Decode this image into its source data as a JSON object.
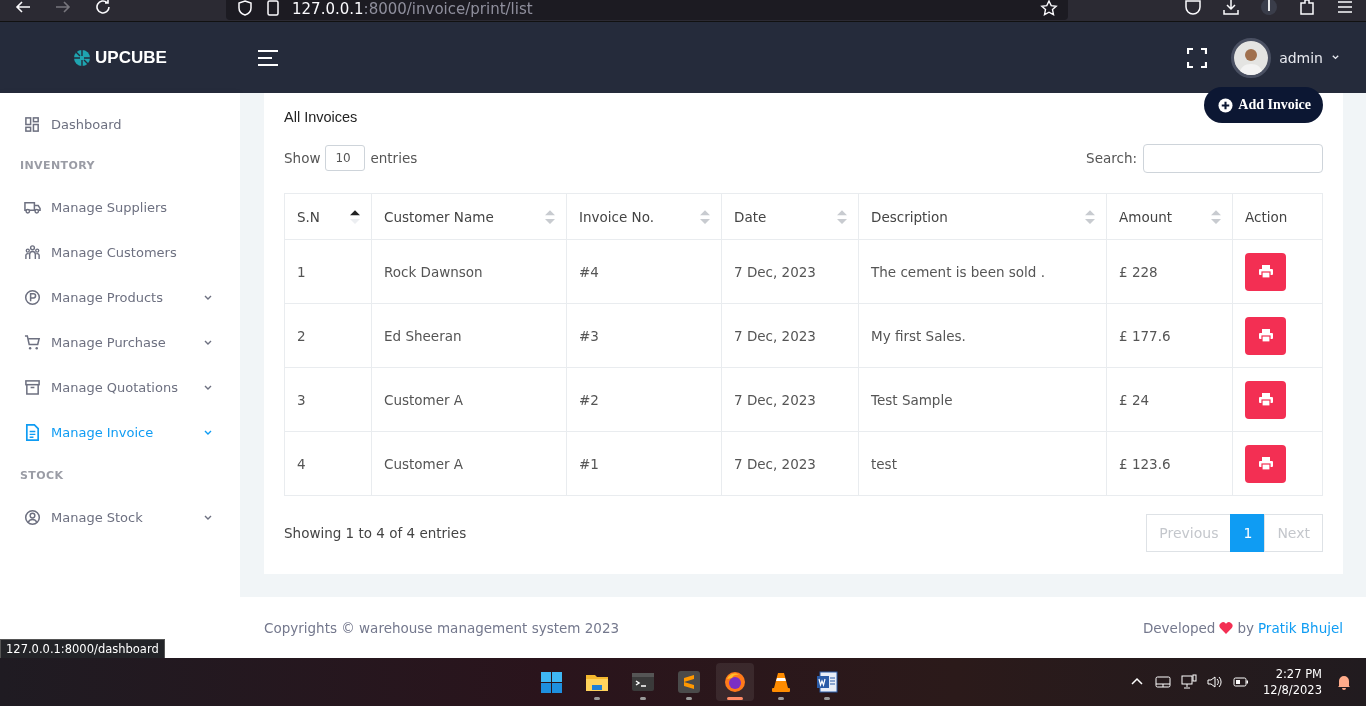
{
  "browser": {
    "url_host": "127.0.0.1",
    "url_rest": ":8000/invoice/print/list"
  },
  "header": {
    "brand": "UPCUBE",
    "user": "admin"
  },
  "sidebar": {
    "items": [
      {
        "kind": "link",
        "label": "Dashboard",
        "selected": false,
        "expandable": false
      },
      {
        "kind": "heading",
        "label": "INVENTORY"
      },
      {
        "kind": "link",
        "label": "Manage Suppliers",
        "selected": false,
        "expandable": false
      },
      {
        "kind": "link",
        "label": "Manage Customers",
        "selected": false,
        "expandable": false
      },
      {
        "kind": "link",
        "label": "Manage Products",
        "selected": false,
        "expandable": true
      },
      {
        "kind": "link",
        "label": "Manage Purchase",
        "selected": false,
        "expandable": true
      },
      {
        "kind": "link",
        "label": "Manage Quotations",
        "selected": false,
        "expandable": true
      },
      {
        "kind": "link",
        "label": "Manage Invoice",
        "selected": true,
        "expandable": true
      },
      {
        "kind": "heading",
        "label": "STOCK"
      },
      {
        "kind": "link",
        "label": "Manage Stock",
        "selected": false,
        "expandable": true
      }
    ]
  },
  "card": {
    "title": "All Invoices",
    "add_button": "Add Invoice",
    "show_label": "Show",
    "page_size": "10",
    "entries_label": "entries",
    "search_label": "Search:",
    "table": {
      "columns": [
        {
          "label": "S.N",
          "sortable": true,
          "sorted": true
        },
        {
          "label": "Customer Name",
          "sortable": true,
          "sorted": false
        },
        {
          "label": "Invoice No.",
          "sortable": true,
          "sorted": false
        },
        {
          "label": "Date",
          "sortable": true,
          "sorted": false
        },
        {
          "label": "Description",
          "sortable": true,
          "sorted": false
        },
        {
          "label": "Amount",
          "sortable": true,
          "sorted": false
        },
        {
          "label": "Action",
          "sortable": false
        }
      ],
      "rows": [
        {
          "cells": [
            "1",
            "Rock Dawnson",
            "#4",
            "7 Dec, 2023",
            "The cement is been sold .",
            "£ 228"
          ]
        },
        {
          "cells": [
            "2",
            "Ed Sheeran",
            "#3",
            "7 Dec, 2023",
            "My first Sales.",
            "£ 177.6"
          ]
        },
        {
          "cells": [
            "3",
            "Customer A",
            "#2",
            "7 Dec, 2023",
            "Test Sample",
            "£ 24"
          ]
        },
        {
          "cells": [
            "4",
            "Customer A",
            "#1",
            "7 Dec, 2023",
            "test",
            "£ 123.6"
          ]
        }
      ]
    },
    "info": "Showing 1 to 4 of 4 entries",
    "pagination": [
      {
        "label": "Previous",
        "disabled": true,
        "selected": false
      },
      {
        "label": "1",
        "disabled": false,
        "selected": true
      },
      {
        "label": "Next",
        "disabled": true,
        "selected": false
      }
    ]
  },
  "footer": {
    "copyright": "Copyrights © warehouse management system 2023",
    "developed": "Developed",
    "by": "by",
    "author": "Pratik Bhujel"
  },
  "status_tooltip": "127.0.0.1:8000/dashboard",
  "taskbar": {
    "apps": [
      {
        "kind": "start",
        "running": false,
        "active": false
      },
      {
        "kind": "folder",
        "running": true,
        "active": false
      },
      {
        "kind": "terminal",
        "running": true,
        "active": false
      },
      {
        "kind": "sublime",
        "running": true,
        "active": false
      },
      {
        "kind": "firefox",
        "running": true,
        "active": true
      },
      {
        "kind": "vlc",
        "running": true,
        "active": false
      },
      {
        "kind": "word",
        "running": true,
        "active": false
      }
    ],
    "time": "2:27 PM",
    "date": "12/8/2023"
  }
}
